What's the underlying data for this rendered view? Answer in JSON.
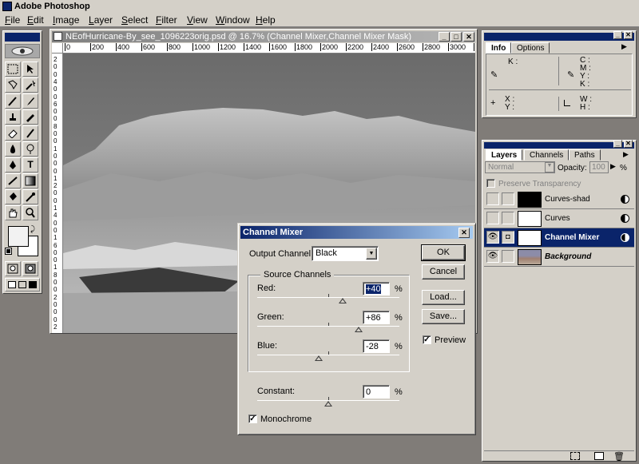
{
  "app": {
    "title": "Adobe Photoshop"
  },
  "menu": [
    "File",
    "Edit",
    "Image",
    "Layer",
    "Select",
    "Filter",
    "View",
    "Window",
    "Help"
  ],
  "document": {
    "title": "NEofHurricane-By_see_1096223orig.psd @ 16.7% (Channel Mixer,Channel Mixer Mask)",
    "ruler_top": [
      "0",
      "200",
      "400",
      "600",
      "800",
      "1000",
      "1200",
      "1400",
      "1600",
      "1800",
      "2000",
      "2200",
      "2400",
      "2600",
      "2800",
      "3000",
      "3200"
    ],
    "ruler_left": [
      "2",
      "0",
      "0",
      "4",
      "0",
      "0",
      "6",
      "0",
      "0",
      "8",
      "0",
      "0",
      "1",
      "0",
      "0",
      "0",
      "1",
      "2",
      "0",
      "0",
      "1",
      "4",
      "0",
      "0",
      "1",
      "6",
      "0",
      "0",
      "1",
      "8",
      "0",
      "0",
      "2",
      "0",
      "0",
      "0",
      "2"
    ]
  },
  "info_panel": {
    "tabs": [
      "Info",
      "Options"
    ],
    "k_label": "K :",
    "cmyk_labels": [
      "C :",
      "M :",
      "Y :",
      "K :"
    ],
    "xy_labels": [
      "X :",
      "Y :"
    ],
    "wh_labels": [
      "W :",
      "H :"
    ]
  },
  "layers_panel": {
    "tabs": [
      "Layers",
      "Channels",
      "Paths"
    ],
    "blend_mode": "Normal",
    "opacity_label": "Opacity:",
    "opacity_value": "100",
    "opacity_unit": "%",
    "preserve_label": "Preserve Transparency",
    "layers": [
      {
        "name": "Curves-shad"
      },
      {
        "name": "Curves"
      },
      {
        "name": "Channel Mixer"
      },
      {
        "name": "Background"
      }
    ]
  },
  "channel_mixer": {
    "title": "Channel Mixer",
    "output_label": "Output Channel:",
    "output_value": "Black",
    "source_label": "Source Channels",
    "red_label": "Red:",
    "red_value": "+40",
    "green_label": "Green:",
    "green_value": "+86",
    "blue_label": "Blue:",
    "blue_value": "-28",
    "constant_label": "Constant:",
    "constant_value": "0",
    "percent": "%",
    "sliders": {
      "red": 40,
      "green": 86,
      "blue": -28,
      "constant": 0
    },
    "buttons": {
      "ok": "OK",
      "cancel": "Cancel",
      "load": "Load...",
      "save": "Save..."
    },
    "preview_label": "Preview",
    "preview_checked": true,
    "monochrome_label": "Monochrome",
    "monochrome_checked": true
  },
  "colors": {
    "titlebar_active": "#0a246a",
    "titlebar_inactive": "#808080",
    "face": "#d4d0c8"
  }
}
